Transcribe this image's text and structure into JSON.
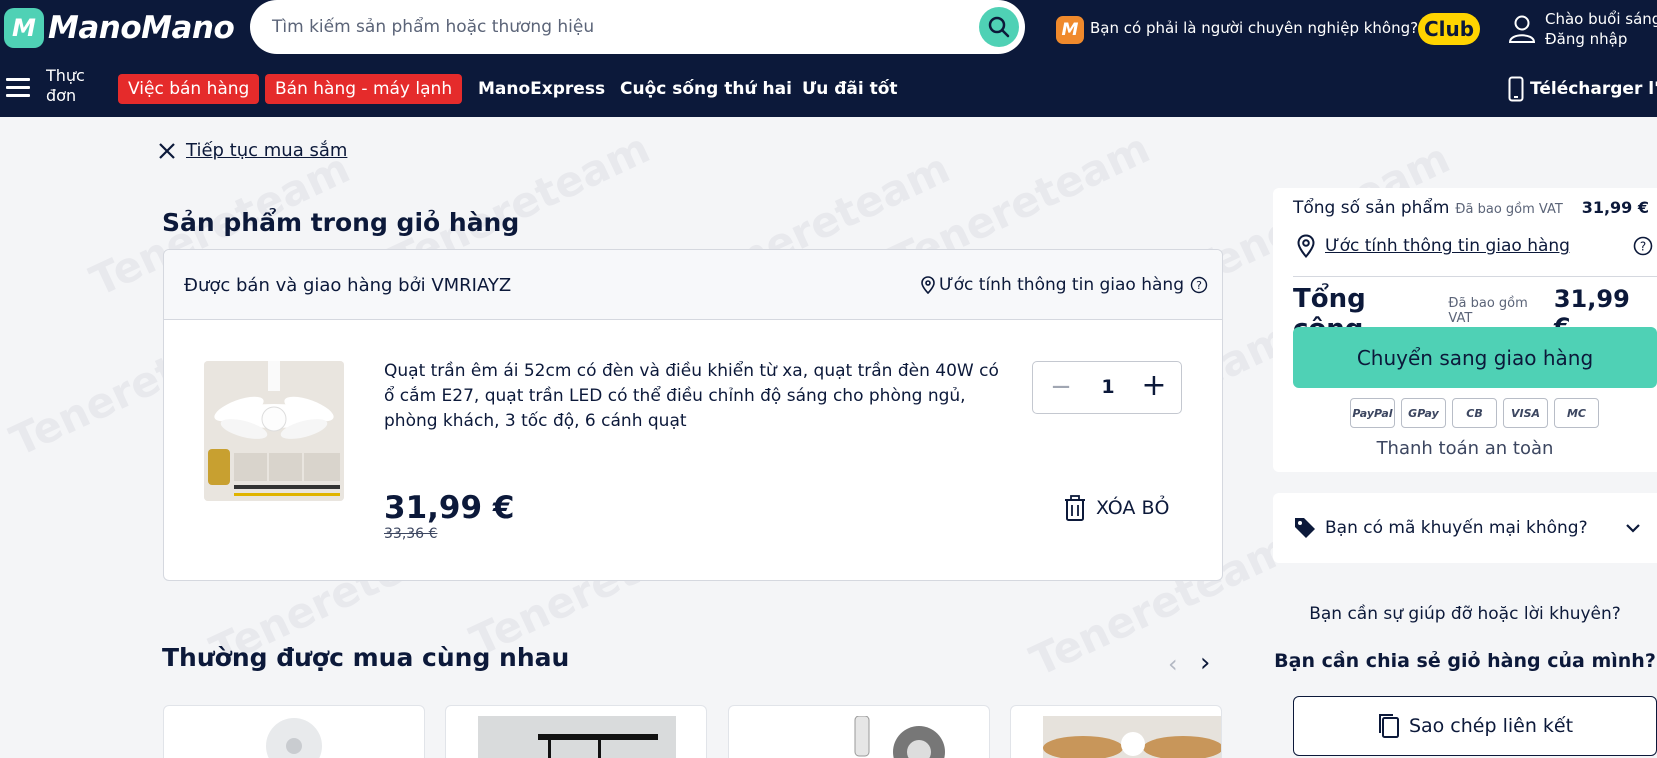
{
  "header": {
    "logo_mark": "M",
    "logo_text": "ManoMano",
    "search_placeholder": "Tìm kiếm sản phẩm hoặc thương hiệu",
    "pro_icon": "M",
    "pro_question": "Bạn có phải là người chuyên nghiệp không?",
    "club": "Club",
    "greeting": "Chào buổi sáng",
    "login": "Đăng nhập"
  },
  "nav": {
    "menu_label": "Thực đơn",
    "pills": [
      "Việc bán hàng",
      "Bán hàng - máy lạnh"
    ],
    "links": [
      "ManoExpress",
      "Cuộc sống thứ hai",
      "Ưu đãi tốt"
    ],
    "app_download": "Télécharger l'ap"
  },
  "main": {
    "continue_shopping": "Tiếp tục mua sắm",
    "cart_title": "Sản phẩm trong giỏ hàng",
    "seller": "Được bán và giao hàng bởi VMRIAYZ",
    "shipping_estimate": "Ước tính thông tin giao hàng",
    "product": {
      "title": "Quạt trần êm ái 52cm có đèn và điều khiển từ xa, quạt trần đèn 40W có ổ cắm E27, quạt trần LED có thể điều chỉnh độ sáng cho phòng ngủ, phòng khách, 3 tốc độ, 6 cánh quạt",
      "quantity": "1",
      "price": "31,99  €",
      "old_price": "33,36 €",
      "remove": "XÓA BỎ"
    },
    "frequently_bought": "Thường được mua cùng nhau"
  },
  "summary": {
    "products_total_label": "Tổng số sản phẩm",
    "vat_note": "Đã bao gồm VAT",
    "products_total": "31,99 €",
    "shipping_link": "Ước tính thông tin giao hàng",
    "total_label": "Tổng cộng",
    "total_vat_note": "Đã bao gồm VAT",
    "total": "31,99  €",
    "checkout": "Chuyển sang giao hàng",
    "payment_methods": [
      "PayPal",
      "GPay",
      "CB",
      "VISA",
      "MC"
    ],
    "secure": "Thanh toán an toàn",
    "promo": "Bạn có mã khuyến mại không?",
    "help": "Bạn cần sự giúp đỡ hoặc lời khuyên?",
    "share": "Bạn cần chia sẻ giỏ hàng của mình?",
    "copy_link": "Sao chép liên kết"
  },
  "colors": {
    "navy": "#0c193a",
    "mint": "#4fd1b5",
    "red": "#e52b2b",
    "yellow": "#ffd400",
    "orange": "#f08a2c"
  },
  "watermark": "Tenereteam"
}
